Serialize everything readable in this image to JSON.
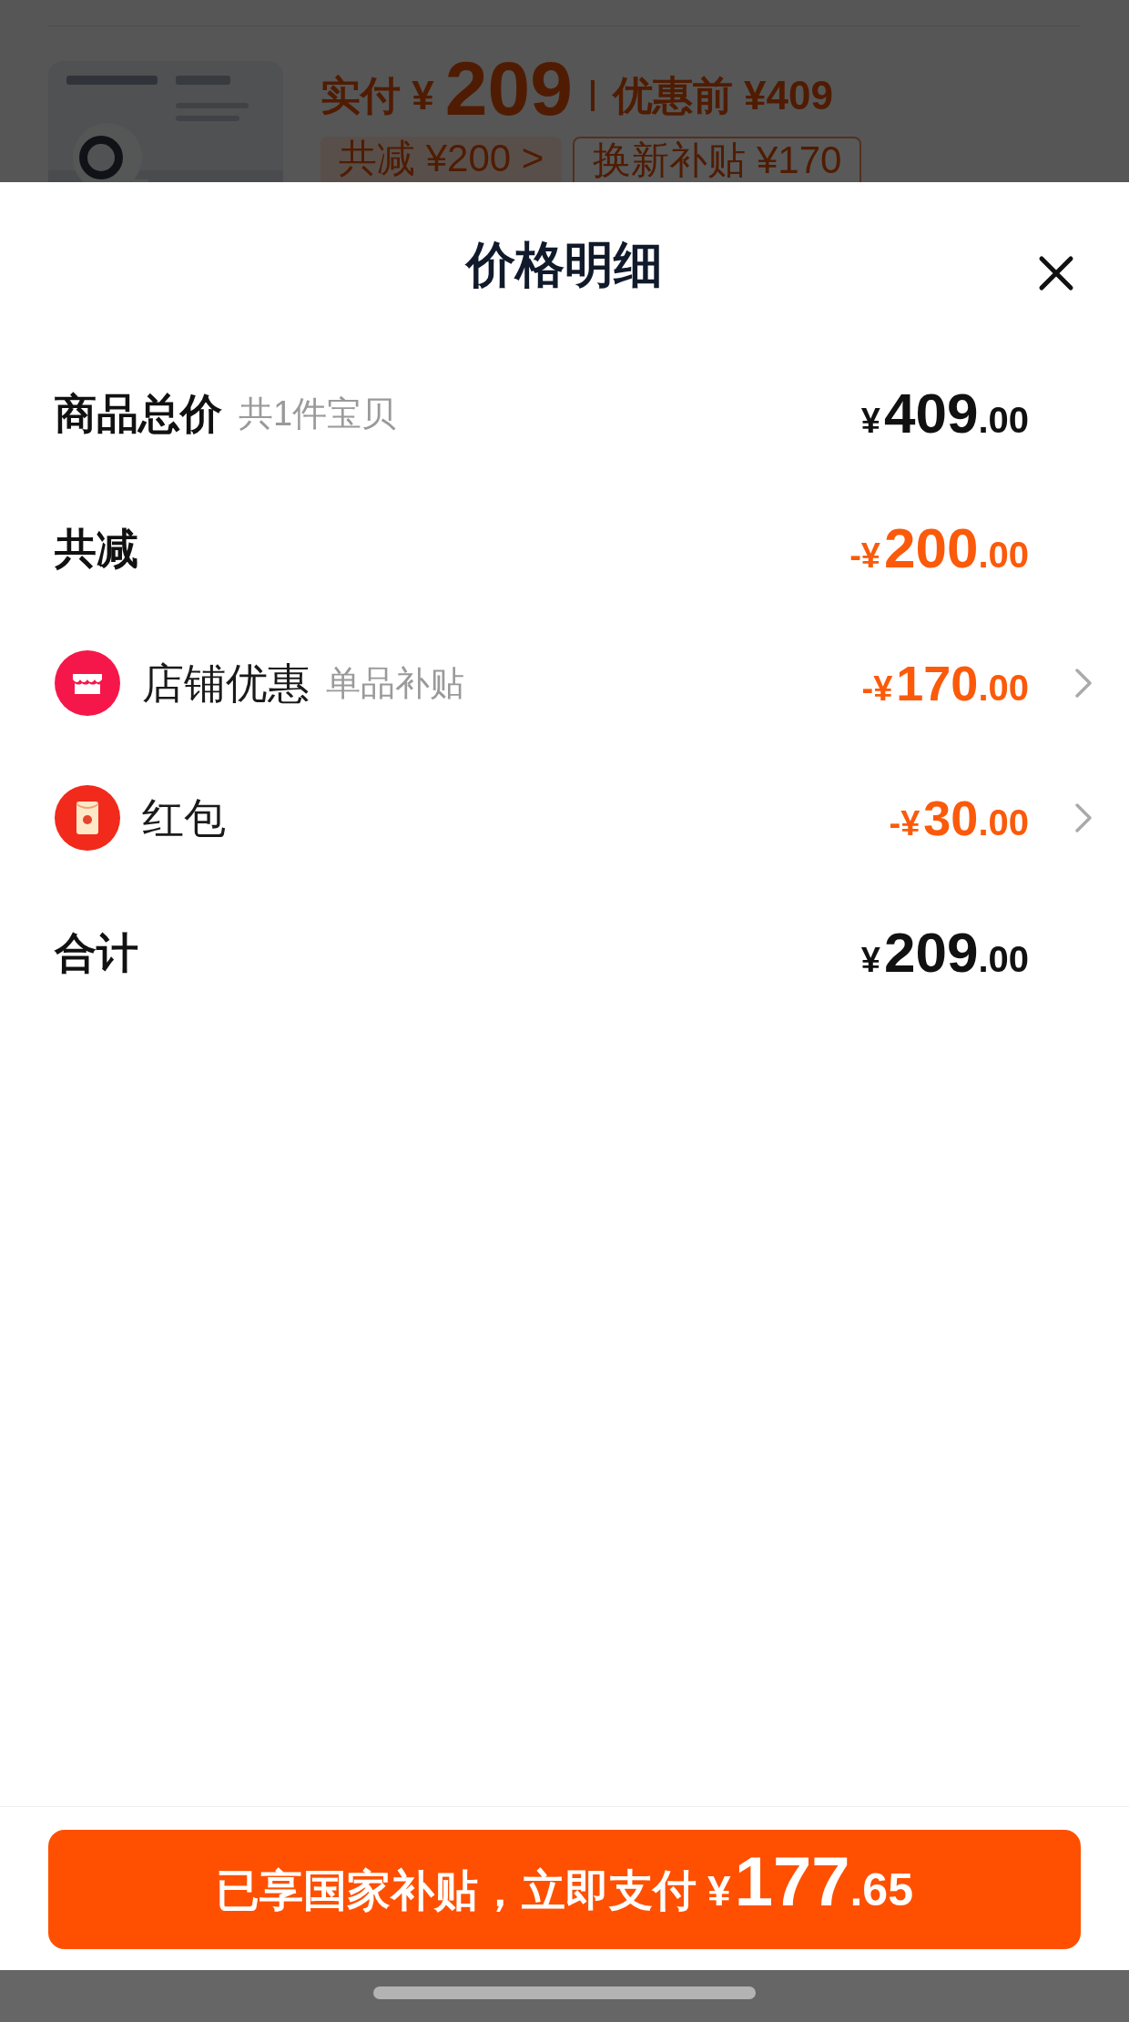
{
  "background": {
    "price_label": "实付 ¥",
    "price": "209",
    "original_price": "优惠前 ¥409",
    "tags": [
      {
        "label": "共减 ¥200 >",
        "kind": "filled"
      },
      {
        "label": "换新补贴 ¥170",
        "kind": "outline"
      }
    ]
  },
  "sheet": {
    "title": "价格明细",
    "rows": [
      {
        "kind": "header",
        "label": "商品总价",
        "note": "共1件宝贝",
        "amount": "¥409.00",
        "deduction": false
      },
      {
        "kind": "header",
        "label": "共减",
        "amount": "-¥200.00",
        "deduction": true
      },
      {
        "kind": "shop_item",
        "label": "店铺优惠",
        "note": "单品补贴",
        "amount": "-¥170.00",
        "deduction": true
      },
      {
        "kind": "envelope_item",
        "label": "红包",
        "amount": "-¥30.00",
        "deduction": true
      },
      {
        "kind": "header",
        "label": "合计",
        "amount": "¥209.00",
        "deduction": false
      }
    ],
    "pay_button": {
      "label": "已享国家补贴，立即支付",
      "amount": "¥177.65"
    }
  }
}
